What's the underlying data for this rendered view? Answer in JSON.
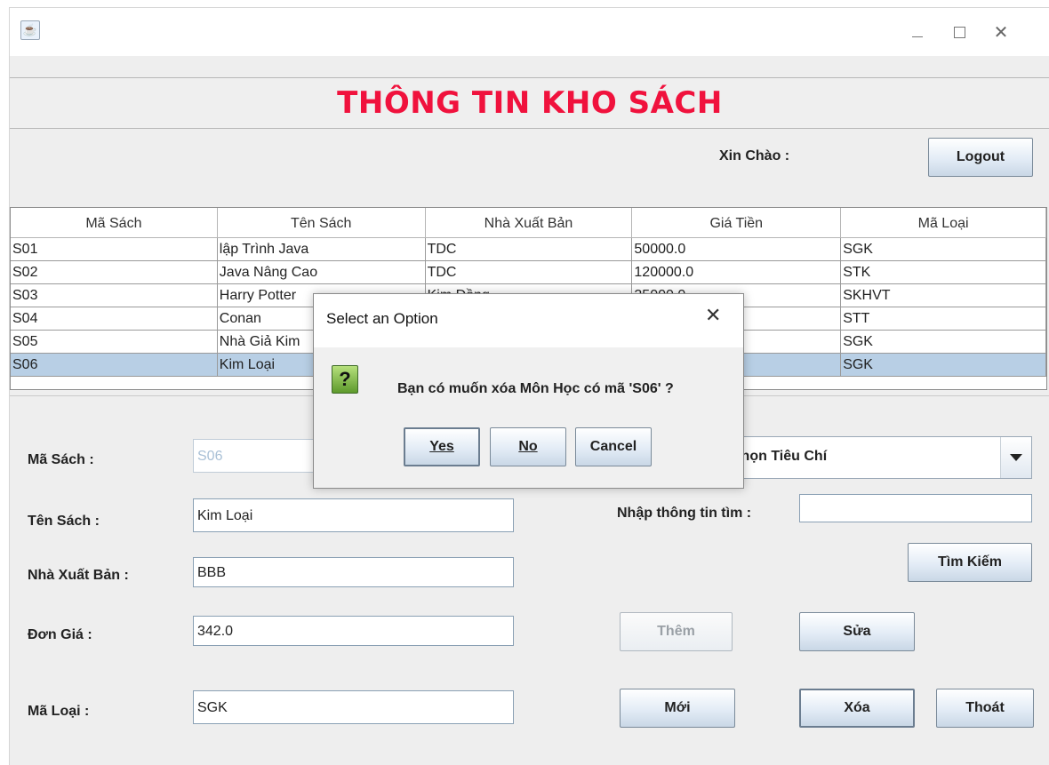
{
  "window": {
    "title": "",
    "controls": {
      "minimize": "—",
      "maximize": "☐",
      "close": "✕"
    }
  },
  "header": {
    "title": "THÔNG TIN KHO SÁCH",
    "greeting": "Xin Chào :",
    "logout_label": "Logout"
  },
  "table": {
    "columns": [
      "Mã Sách",
      "Tên Sách",
      "Nhà Xuất Bản",
      "Giá Tiền",
      "Mã Loại"
    ],
    "rows": [
      [
        "S01",
        "lập Trình Java",
        "TDC",
        "50000.0",
        "SGK"
      ],
      [
        "S02",
        "Java Nâng Cao",
        "TDC",
        "120000.0",
        "STK"
      ],
      [
        "S03",
        "Harry Potter",
        "Kim Đồng",
        "35000.0",
        "SKHVT"
      ],
      [
        "S04",
        "Conan",
        "",
        "",
        "STT"
      ],
      [
        "S05",
        "Nhà Giả Kim",
        "",
        "",
        "SGK"
      ],
      [
        "S06",
        "Kim Loại",
        "",
        "",
        "SGK"
      ]
    ],
    "selected_row": 5
  },
  "form": {
    "ma_sach_label": "Mã Sách :",
    "ma_sach_value": "S06",
    "ten_sach_label": "Tên Sách :",
    "ten_sach_value": "Kim Loại",
    "nxb_label": "Nhà Xuất Bản :",
    "nxb_value": "BBB",
    "don_gia_label": "Đơn Giá :",
    "don_gia_value": "342.0",
    "ma_loai_label": "Mã Loại :",
    "ma_loai_value": "SGK"
  },
  "search": {
    "criteria_selected": "Chọn Tiêu Chí",
    "input_label": "Nhập thông tin tìm :",
    "input_value": "",
    "search_button": "Tìm Kiếm"
  },
  "actions": {
    "add": "Thêm",
    "edit": "Sửa",
    "new": "Mới",
    "delete": "Xóa",
    "exit": "Thoát"
  },
  "dialog": {
    "title": "Select an Option",
    "close": "✕",
    "icon": "question-icon",
    "message": "Bạn có muốn xóa Môn Học có mã 'S06' ?",
    "yes": "Yes",
    "no": "No",
    "cancel": "Cancel"
  }
}
